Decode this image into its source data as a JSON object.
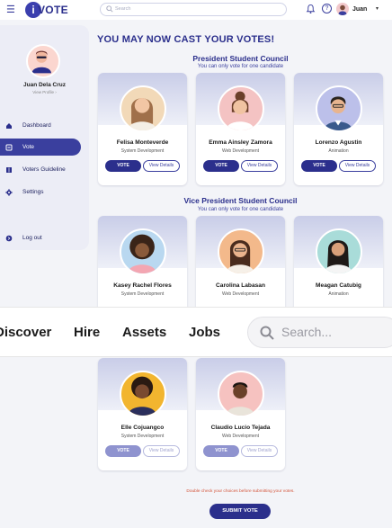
{
  "app": {
    "logo_letter": "i",
    "logo_text": "VOTE"
  },
  "topbar": {
    "search_placeholder": "Search",
    "user_name": "Juan",
    "icons": [
      "menu-icon",
      "search-icon",
      "bell-icon",
      "help-icon",
      "chevron-down-icon"
    ]
  },
  "sidebar": {
    "profile_name": "Juan Dela Cruz",
    "profile_link": "View Profile  ›",
    "items": [
      {
        "label": "Dashboard",
        "icon": "home-icon"
      },
      {
        "label": "Vote",
        "icon": "ballot-icon",
        "active": true
      },
      {
        "label": "Voters Guideline",
        "icon": "book-icon"
      },
      {
        "label": "Settings",
        "icon": "gear-icon"
      },
      {
        "label": "Log out",
        "icon": "logout-icon"
      }
    ]
  },
  "main": {
    "heading": "YOU MAY NOW CAST YOUR VOTES!",
    "sections": [
      {
        "title": "President Student Council",
        "subtitle": "You can only vote for one candidate",
        "candidates": [
          {
            "name": "Felisa Monteverde",
            "role": "System Development",
            "photo_bg": "#f2d9b8"
          },
          {
            "name": "Emma Ainsley Zamora",
            "role": "Web Development",
            "photo_bg": "#f4c3c3"
          },
          {
            "name": "Lorenzo Agustin",
            "role": "Animation",
            "photo_bg": "#bcc0ea"
          }
        ]
      },
      {
        "title": "Vice President Student Council",
        "subtitle": "You can only vote for one candidate",
        "candidates": [
          {
            "name": "Kasey Rachel Flores",
            "role": "System Development",
            "photo_bg": "#b9d8f0"
          },
          {
            "name": "Carolina Labasan",
            "role": "Web Development",
            "photo_bg": "#f3b98b"
          },
          {
            "name": "Meagan Catubig",
            "role": "Animation",
            "photo_bg": "#a9dcd9"
          }
        ]
      },
      {
        "title": "",
        "subtitle": "",
        "candidates": [
          {
            "name": "Elle Cojuangco",
            "role": "System Development",
            "photo_bg": "#f2b52f"
          },
          {
            "name": "Claudio Lucio Tejada",
            "role": "Web Development",
            "photo_bg": "#f6c2c0"
          }
        ]
      }
    ],
    "vote_label": "VOTE",
    "details_label": "View Details",
    "note": "Double check your choices before submitting your votes.",
    "submit_label": "SUBMIT VOTE"
  },
  "overlay": {
    "links": [
      "Discover",
      "Hire",
      "Assets",
      "Jobs"
    ],
    "search_placeholder": "Search..."
  }
}
